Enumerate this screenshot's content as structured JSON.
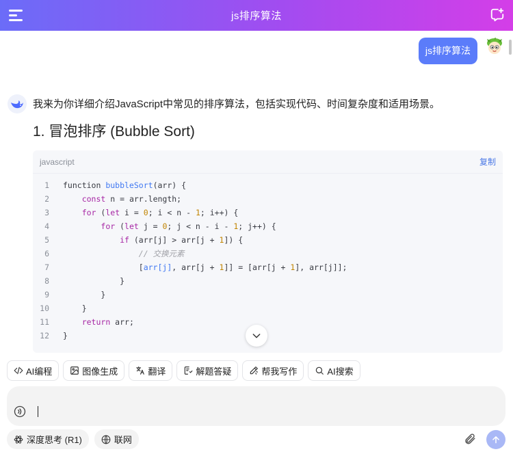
{
  "header": {
    "title": "js排序算法"
  },
  "user_message": {
    "text": "js排序算法"
  },
  "assistant": {
    "intro": "我来为你详细介绍JavaScript中常见的排序算法，包括实现代码、时间复杂度和适用场景。",
    "heading": "1. 冒泡排序 (Bubble Sort)",
    "code": {
      "language": "javascript",
      "copy_label": "复制",
      "lines": [
        {
          "n": "1",
          "tokens": [
            [
              "tx",
              "function "
            ],
            [
              "fn",
              "bubbleSort"
            ],
            [
              "tx",
              "(arr) {"
            ]
          ]
        },
        {
          "n": "2",
          "tokens": [
            [
              "tx",
              "    "
            ],
            [
              "kw",
              "const"
            ],
            [
              "tx",
              " n = arr.length;"
            ]
          ]
        },
        {
          "n": "3",
          "tokens": [
            [
              "tx",
              "    "
            ],
            [
              "kw",
              "for"
            ],
            [
              "tx",
              " ("
            ],
            [
              "kw",
              "let"
            ],
            [
              "tx",
              " i = "
            ],
            [
              "num",
              "0"
            ],
            [
              "tx",
              "; i < n - "
            ],
            [
              "num",
              "1"
            ],
            [
              "tx",
              "; i++) {"
            ]
          ]
        },
        {
          "n": "4",
          "tokens": [
            [
              "tx",
              "        "
            ],
            [
              "kw",
              "for"
            ],
            [
              "tx",
              " ("
            ],
            [
              "kw",
              "let"
            ],
            [
              "tx",
              " j = "
            ],
            [
              "num",
              "0"
            ],
            [
              "tx",
              "; j < n - i - "
            ],
            [
              "num",
              "1"
            ],
            [
              "tx",
              "; j++) {"
            ]
          ]
        },
        {
          "n": "5",
          "tokens": [
            [
              "tx",
              "            "
            ],
            [
              "kw",
              "if"
            ],
            [
              "tx",
              " (arr[j] > arr[j + "
            ],
            [
              "num",
              "1"
            ],
            [
              "tx",
              "]) {"
            ]
          ]
        },
        {
          "n": "6",
          "tokens": [
            [
              "tx",
              "                "
            ],
            [
              "cm",
              "// 交换元素"
            ]
          ]
        },
        {
          "n": "7",
          "tokens": [
            [
              "tx",
              "                ["
            ],
            [
              "fn",
              "arr[j]"
            ],
            [
              "tx",
              ", arr[j + "
            ],
            [
              "num",
              "1"
            ],
            [
              "tx",
              "]] = [arr[j + "
            ],
            [
              "num",
              "1"
            ],
            [
              "tx",
              "], arr[j]];"
            ]
          ]
        },
        {
          "n": "8",
          "tokens": [
            [
              "tx",
              "            }"
            ]
          ]
        },
        {
          "n": "9",
          "tokens": [
            [
              "tx",
              "        }"
            ]
          ]
        },
        {
          "n": "10",
          "tokens": [
            [
              "tx",
              "    }"
            ]
          ]
        },
        {
          "n": "11",
          "tokens": [
            [
              "tx",
              "    "
            ],
            [
              "kw",
              "return"
            ],
            [
              "tx",
              " arr;"
            ]
          ]
        },
        {
          "n": "12",
          "tokens": [
            [
              "tx",
              "}"
            ]
          ]
        }
      ]
    }
  },
  "tools": [
    {
      "icon": "code-icon",
      "label": "AI编程"
    },
    {
      "icon": "image-icon",
      "label": "图像生成"
    },
    {
      "icon": "translate-icon",
      "label": "翻译"
    },
    {
      "icon": "solve-icon",
      "label": "解题答疑"
    },
    {
      "icon": "pen-icon",
      "label": "帮我写作"
    },
    {
      "icon": "search-icon",
      "label": "AI搜索"
    }
  ],
  "input": {
    "value": "",
    "placeholder": ""
  },
  "bottom": {
    "deep_think_label": "深度思考 (R1)",
    "web_label": "联网"
  },
  "colors": {
    "accent": "#5b7cfa",
    "header_start": "#6b6cf8",
    "header_end": "#d43ee8"
  }
}
